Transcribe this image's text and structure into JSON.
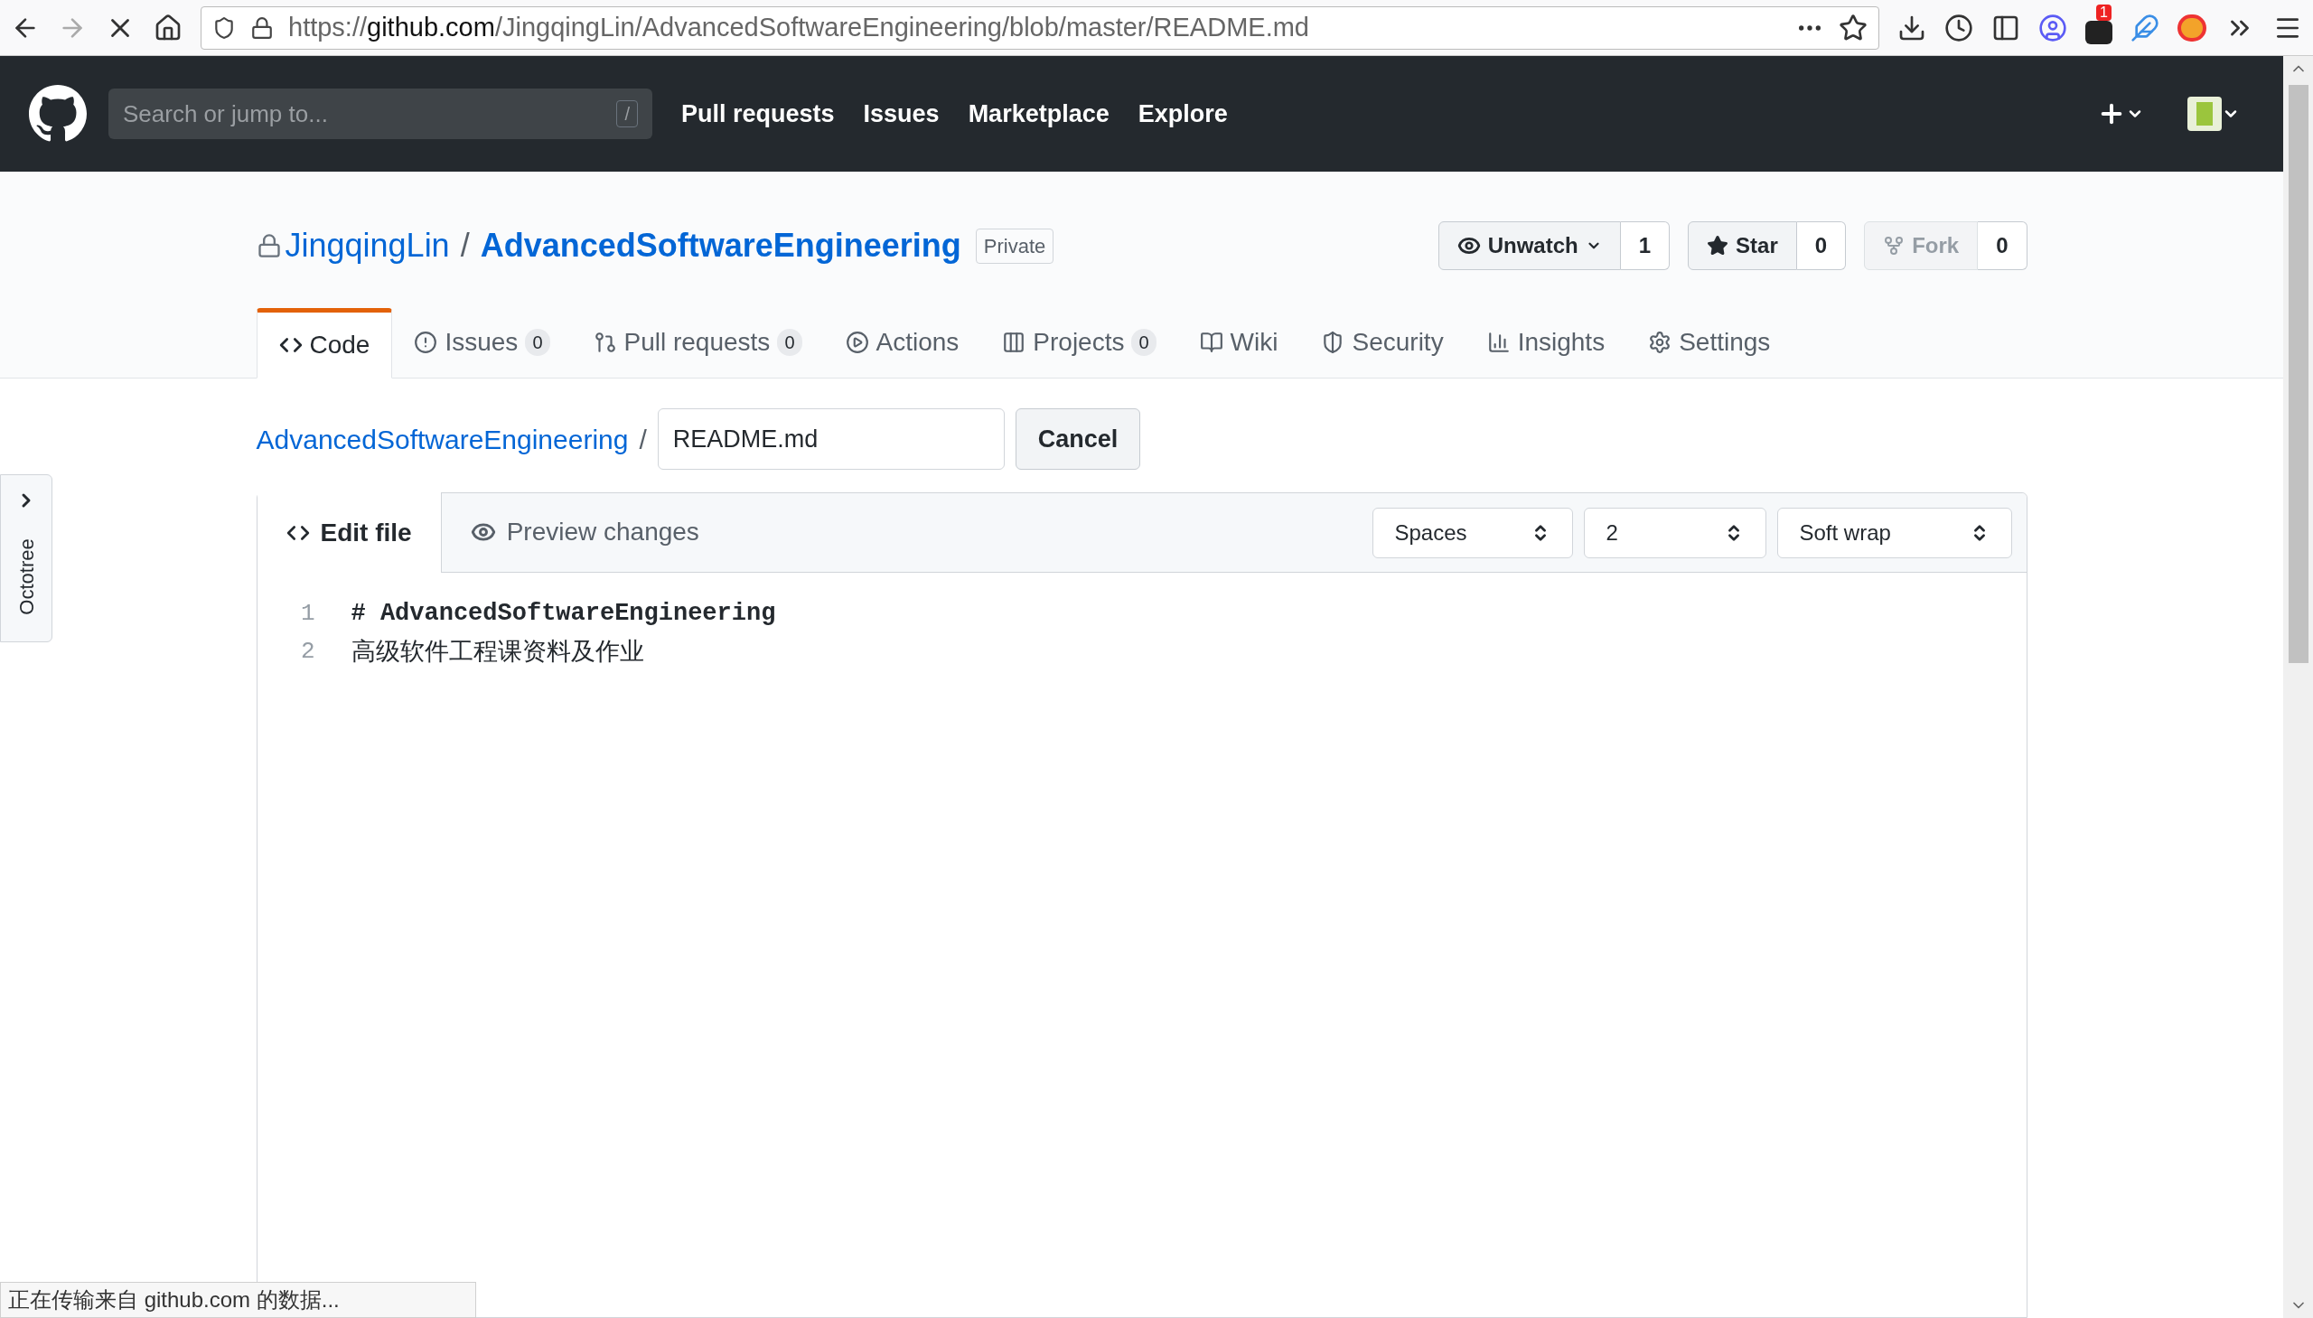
{
  "browser": {
    "url": {
      "prefix": "https://",
      "host": "github.com",
      "path": "/JingqingLin/AdvancedSoftwareEngineering/blob/master/README.md"
    },
    "extension_badge": "1"
  },
  "header": {
    "search_placeholder": "Search or jump to...",
    "search_key": "/",
    "nav": [
      "Pull requests",
      "Issues",
      "Marketplace",
      "Explore"
    ]
  },
  "repo": {
    "owner": "JingqingLin",
    "separator": "/",
    "name": "AdvancedSoftwareEngineering",
    "visibility": "Private",
    "actions": [
      {
        "kind": "watch",
        "label": "Unwatch",
        "count": "1",
        "disabled": false
      },
      {
        "kind": "star",
        "label": "Star",
        "count": "0",
        "disabled": false
      },
      {
        "kind": "fork",
        "label": "Fork",
        "count": "0",
        "disabled": true
      }
    ]
  },
  "tabs": [
    {
      "kind": "code",
      "label": "Code",
      "selected": true
    },
    {
      "kind": "issues",
      "label": "Issues",
      "count": "0",
      "selected": false
    },
    {
      "kind": "pulls",
      "label": "Pull requests",
      "count": "0",
      "selected": false
    },
    {
      "kind": "actions",
      "label": "Actions",
      "selected": false
    },
    {
      "kind": "projects",
      "label": "Projects",
      "count": "0",
      "selected": false
    },
    {
      "kind": "wiki",
      "label": "Wiki",
      "selected": false
    },
    {
      "kind": "security",
      "label": "Security",
      "selected": false
    },
    {
      "kind": "insights",
      "label": "Insights",
      "selected": false
    },
    {
      "kind": "settings",
      "label": "Settings",
      "selected": false
    }
  ],
  "breadcrumb": {
    "repo": "AdvancedSoftwareEngineering",
    "separator": "/",
    "filename": "README.md",
    "cancel": "Cancel"
  },
  "editor": {
    "tabs": [
      {
        "kind": "edit",
        "label": "Edit file",
        "selected": true
      },
      {
        "kind": "preview",
        "label": "Preview changes",
        "selected": false
      }
    ],
    "selects": [
      {
        "value": "Spaces"
      },
      {
        "value": "2"
      },
      {
        "value": "Soft wrap"
      }
    ],
    "lines": [
      {
        "number": "1",
        "kind": "heading",
        "text": "# AdvancedSoftwareEngineering"
      },
      {
        "number": "2",
        "kind": "text",
        "text": "高级软件工程课资料及作业"
      }
    ]
  },
  "octotree": {
    "label": "Octotree"
  },
  "status_bar": {
    "text": "正在传输来自 github.com 的数据..."
  }
}
